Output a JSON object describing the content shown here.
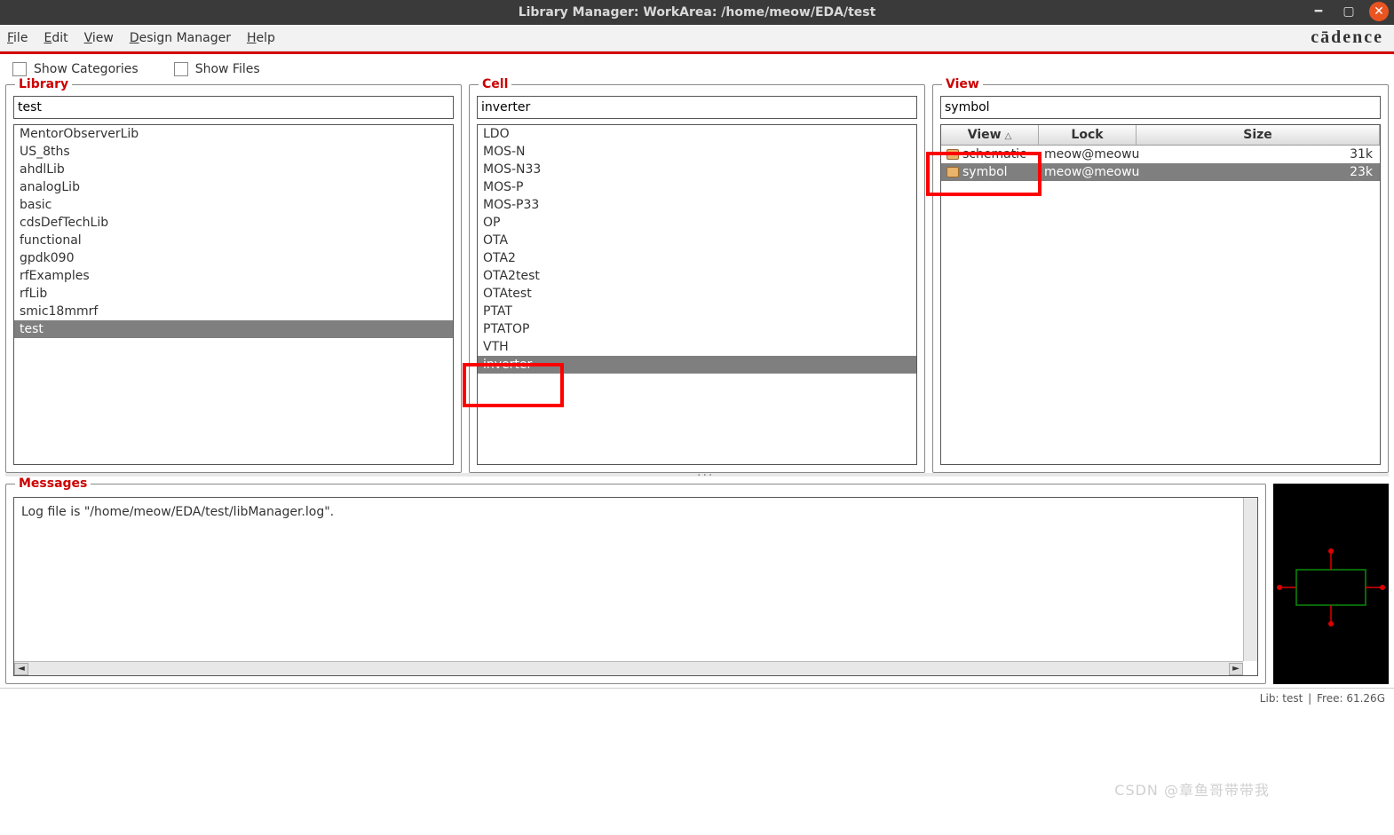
{
  "titlebar": {
    "title": "Library Manager: WorkArea: /home/meow/EDA/test"
  },
  "menu": {
    "file": "File",
    "edit": "Edit",
    "view": "View",
    "design_manager": "Design Manager",
    "help": "Help"
  },
  "brand": "cādence",
  "options": {
    "show_categories": "Show Categories",
    "show_files": "Show Files"
  },
  "panels": {
    "library": {
      "legend": "Library",
      "filter": "test",
      "items": [
        "MentorObserverLib",
        "US_8ths",
        "ahdlLib",
        "analogLib",
        "basic",
        "cdsDefTechLib",
        "functional",
        "gpdk090",
        "rfExamples",
        "rfLib",
        "smic18mmrf",
        "test"
      ],
      "selected": "test"
    },
    "cell": {
      "legend": "Cell",
      "filter": "inverter",
      "items": [
        "LDO",
        "MOS-N",
        "MOS-N33",
        "MOS-P",
        "MOS-P33",
        "OP",
        "OTA",
        "OTA2",
        "OTA2test",
        "OTAtest",
        "PTAT",
        "PTATOP",
        "VTH",
        "inverter"
      ],
      "selected": "inverter"
    },
    "view": {
      "legend": "View",
      "filter": "symbol",
      "columns": {
        "view": "View",
        "lock": "Lock",
        "size": "Size"
      },
      "rows": [
        {
          "view": "schematic",
          "lock": "meow@meowu",
          "size": "31k",
          "selected": false
        },
        {
          "view": "symbol",
          "lock": "meow@meowu",
          "size": "23k",
          "selected": true
        }
      ]
    }
  },
  "messages": {
    "legend": "Messages",
    "text": "Log file is \"/home/meow/EDA/test/libManager.log\"."
  },
  "status": {
    "lib": "Lib: test",
    "free": "Free: 61.26G"
  },
  "watermark": "CSDN @章鱼哥带带我"
}
